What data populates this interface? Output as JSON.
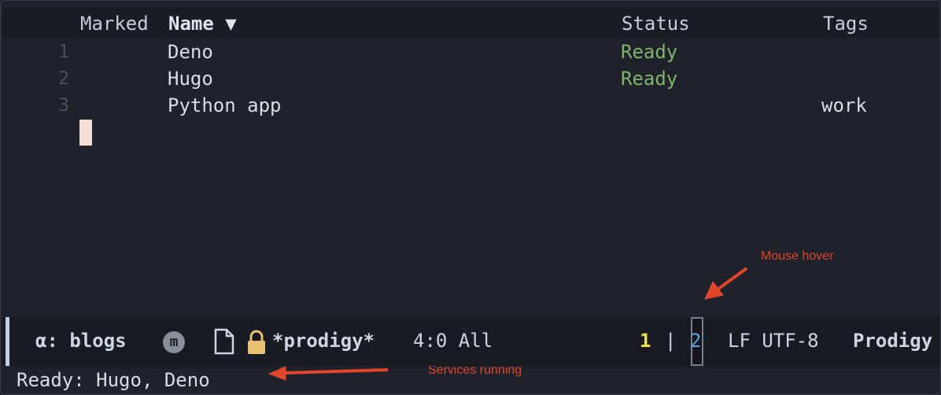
{
  "table": {
    "headers": {
      "marked": "Marked",
      "name": "Name ▼",
      "status": "Status",
      "tags": "Tags"
    },
    "rows": [
      {
        "line": "1",
        "name": "Deno",
        "status": "Ready",
        "tags": ""
      },
      {
        "line": "2",
        "name": "Hugo",
        "status": "Ready",
        "tags": ""
      },
      {
        "line": "3",
        "name": "Python app",
        "status": "",
        "tags": "work"
      }
    ]
  },
  "modeline": {
    "workspace": "α: blogs",
    "m_badge": "m",
    "buffer_name": "*prodigy*",
    "position": "4:0 All",
    "window_one": "1",
    "separator": "|",
    "window_two": "2",
    "encoding": "LF UTF-8",
    "major_mode": "Prodigy"
  },
  "echo_area": "Ready: Hugo, Deno",
  "annotations": {
    "hover": "Mouse hover",
    "services": "Services running"
  },
  "colors": {
    "status_ready": "#7fb56a",
    "window_one": "#f2e24a",
    "window_two": "#5ba4e8",
    "annotation": "#e2462a"
  }
}
